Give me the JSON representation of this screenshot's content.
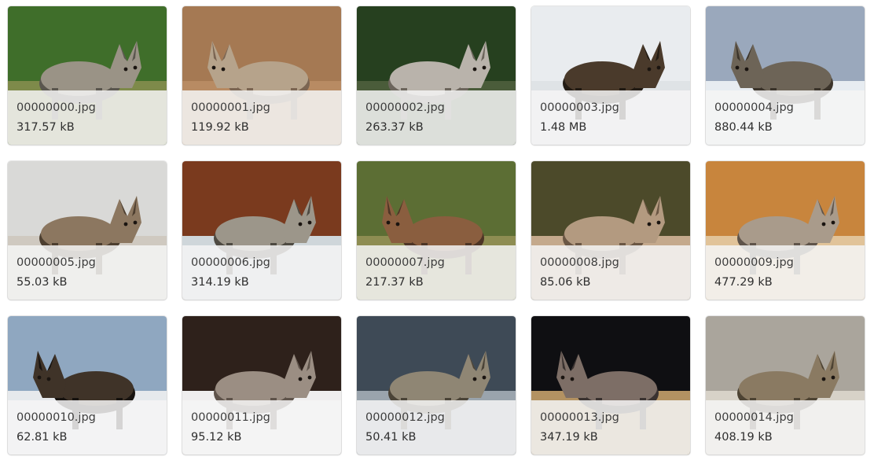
{
  "gallery": {
    "items": [
      {
        "name": "00000000.jpg",
        "size": "317.57 kB",
        "thumbnail": "wolf-photo-icon",
        "palette": {
          "bg": "#3f6e2a",
          "ground": "#7e8a4a",
          "subject": "#9a9386",
          "shade": "#5a564e"
        }
      },
      {
        "name": "00000001.jpg",
        "size": "119.92 kB",
        "thumbnail": "wolf-photo-icon",
        "palette": {
          "bg": "#a57953",
          "ground": "#b88b63",
          "subject": "#b6a38b",
          "shade": "#7b6552"
        }
      },
      {
        "name": "00000002.jpg",
        "size": "263.37 kB",
        "thumbnail": "wolf-photo-icon",
        "palette": {
          "bg": "#26401f",
          "ground": "#4a5c3a",
          "subject": "#b9b3ab",
          "shade": "#6c655c"
        }
      },
      {
        "name": "00000003.jpg",
        "size": "1.48 MB",
        "thumbnail": "wolf-photo-icon",
        "palette": {
          "bg": "#e9ecef",
          "ground": "#dfe3e6",
          "subject": "#4a3a2b",
          "shade": "#221b14"
        }
      },
      {
        "name": "00000004.jpg",
        "size": "880.44 kB",
        "thumbnail": "wolf-photo-icon",
        "palette": {
          "bg": "#9aa8bc",
          "ground": "#e7ecf1",
          "subject": "#6d6457",
          "shade": "#3b342b"
        }
      },
      {
        "name": "00000005.jpg",
        "size": "55.03 kB",
        "thumbnail": "wolf-photo-icon",
        "palette": {
          "bg": "#d9d9d7",
          "ground": "#cfc9c0",
          "subject": "#8c7760",
          "shade": "#4d3f30"
        }
      },
      {
        "name": "00000006.jpg",
        "size": "314.19 kB",
        "thumbnail": "wolf-photo-icon",
        "palette": {
          "bg": "#7a3a1e",
          "ground": "#cfd6da",
          "subject": "#9c968a",
          "shade": "#4e4a42"
        }
      },
      {
        "name": "00000007.jpg",
        "size": "217.37 kB",
        "thumbnail": "wolf-photo-icon",
        "palette": {
          "bg": "#5c6e34",
          "ground": "#8e8d52",
          "subject": "#8a5e3f",
          "shade": "#4d3526"
        }
      },
      {
        "name": "00000008.jpg",
        "size": "85.06 kB",
        "thumbnail": "wolf-photo-icon",
        "palette": {
          "bg": "#4c4a2a",
          "ground": "#c4a98c",
          "subject": "#b39a80",
          "shade": "#6b5744"
        }
      },
      {
        "name": "00000009.jpg",
        "size": "477.29 kB",
        "thumbnail": "wolf-photo-icon",
        "palette": {
          "bg": "#c8853d",
          "ground": "#e1c399",
          "subject": "#a99b8b",
          "shade": "#5f544a"
        }
      },
      {
        "name": "00000010.jpg",
        "size": "62.81 kB",
        "thumbnail": "wolf-photo-icon",
        "palette": {
          "bg": "#8fa7c0",
          "ground": "#e6e9ec",
          "subject": "#3f3328",
          "shade": "#171310"
        }
      },
      {
        "name": "00000011.jpg",
        "size": "95.12 kB",
        "thumbnail": "wolf-photo-icon",
        "palette": {
          "bg": "#2e211b",
          "ground": "#efeeee",
          "subject": "#9b8e83",
          "shade": "#5e534a"
        }
      },
      {
        "name": "00000012.jpg",
        "size": "50.41 kB",
        "thumbnail": "wolf-photo-icon",
        "palette": {
          "bg": "#3e4a56",
          "ground": "#9aa4ad",
          "subject": "#8f8674",
          "shade": "#4a4337"
        }
      },
      {
        "name": "00000013.jpg",
        "size": "347.19 kB",
        "thumbnail": "wolf-photo-icon",
        "palette": {
          "bg": "#0f0f12",
          "ground": "#b39262",
          "subject": "#7d6e66",
          "shade": "#3a3230"
        }
      },
      {
        "name": "00000014.jpg",
        "size": "408.19 kB",
        "thumbnail": "wolf-photo-icon",
        "palette": {
          "bg": "#aaa59c",
          "ground": "#d7d2c8",
          "subject": "#8a7a62",
          "shade": "#4d4333"
        }
      }
    ]
  }
}
